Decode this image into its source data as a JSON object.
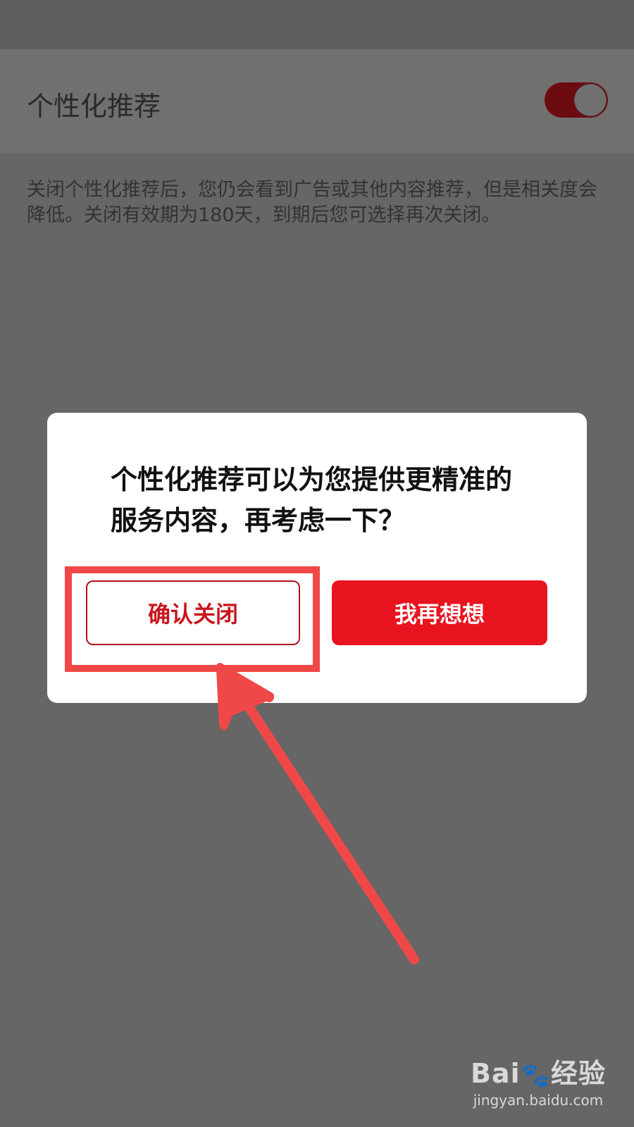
{
  "setting": {
    "label": "个性化推荐",
    "toggle_on": true,
    "description": "关闭个性化推荐后，您仍会看到广告或其他内容推荐，但是相关度会降低。关闭有效期为180天，到期后您可选择再次关闭。"
  },
  "dialog": {
    "title": "个性化推荐可以为您提供更精准的服务内容，再考虑一下？",
    "confirm_label": "确认关闭",
    "rethink_label": "我再想想"
  },
  "watermark": {
    "logo_left": "Bai",
    "logo_right": "经验",
    "url": "jingyan.baidu.com"
  },
  "colors": {
    "overlay": "#666666",
    "accent": "#e8141f",
    "annotation": "#f04848"
  }
}
